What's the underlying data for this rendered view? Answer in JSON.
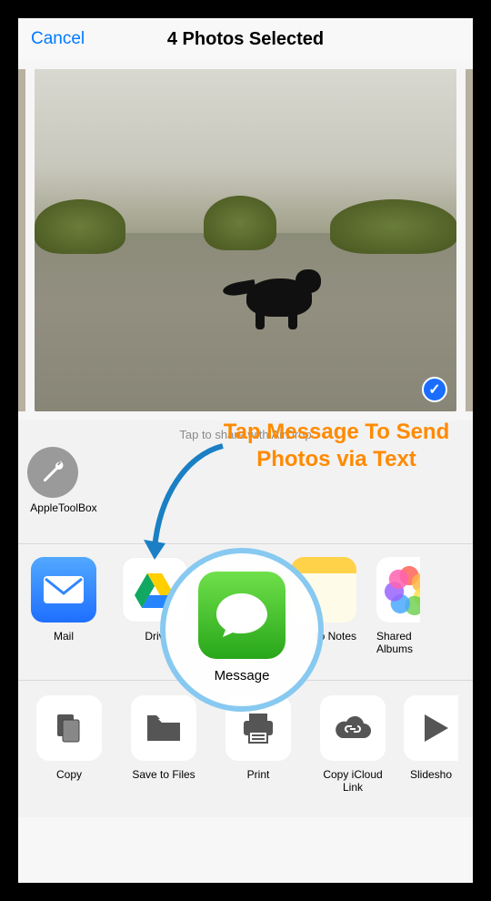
{
  "header": {
    "cancel": "Cancel",
    "title": "4 Photos Selected"
  },
  "photo": {
    "selected": true,
    "check_symbol": "✓"
  },
  "airdrop": {
    "hint": "Tap to share with AirDrop",
    "item": {
      "label": "AppleToolBox",
      "icon": "wrench"
    }
  },
  "apps": [
    {
      "name": "mail",
      "label": "Mail"
    },
    {
      "name": "drive",
      "label": "Driv"
    },
    {
      "name": "notes",
      "label": "to Notes"
    },
    {
      "name": "shared-albums",
      "label": "Shared\nAlbums"
    }
  ],
  "actions": [
    {
      "name": "copy",
      "label": "Copy"
    },
    {
      "name": "save-to-files",
      "label": "Save to Files"
    },
    {
      "name": "print",
      "label": "Print"
    },
    {
      "name": "copy-icloud-link",
      "label": "Copy iCloud\nLink"
    },
    {
      "name": "slideshow",
      "label": "Slidesho"
    }
  ],
  "annotation": {
    "text": "Tap Message To Send Photos via Text",
    "circle_label": "Message",
    "accent": "#ff8a00",
    "circle_stroke": "#87c9f0"
  }
}
